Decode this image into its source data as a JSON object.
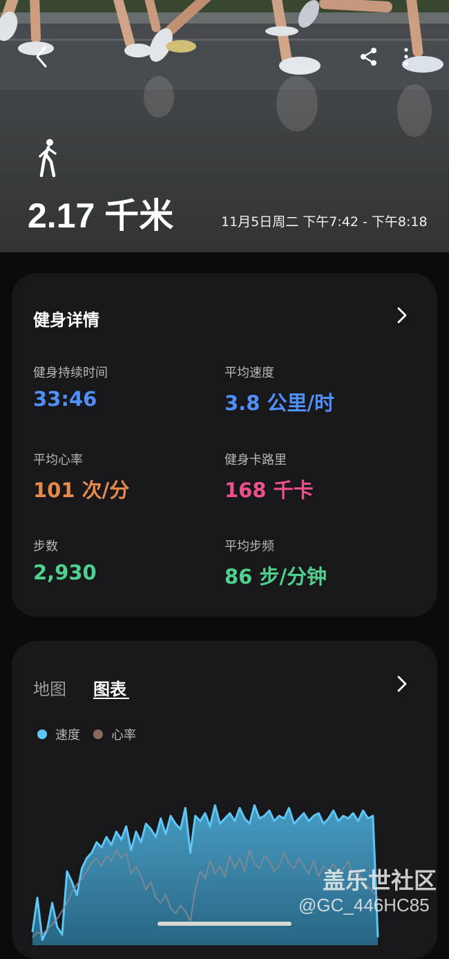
{
  "hero": {
    "distance": "2.17 千米",
    "datetime": "11月5日周二 下午7:42 - 下午8:18",
    "activity_icon": "walk-icon"
  },
  "details": {
    "title": "健身详情",
    "metrics": [
      {
        "label": "健身持续时间",
        "value": "33:46",
        "color": "#4f8ff7"
      },
      {
        "label": "平均速度",
        "value": "3.8 公里/时",
        "color": "#4f8ff7"
      },
      {
        "label": "平均心率",
        "value": "101 次/分",
        "color": "#e58a4c"
      },
      {
        "label": "健身卡路里",
        "value": "168 千卡",
        "color": "#ef4f8f"
      },
      {
        "label": "步数",
        "value": "2,930",
        "color": "#4fd08c"
      },
      {
        "label": "平均步频",
        "value": "86 步/分钟",
        "color": "#4fd08c"
      }
    ]
  },
  "chart_panel": {
    "tabs": [
      {
        "label": "地图",
        "active": false
      },
      {
        "label": "图表",
        "active": true
      }
    ],
    "legend": [
      {
        "label": "速度",
        "color": "#5ec6f5"
      },
      {
        "label": "心率",
        "color": "#8a6a5e"
      }
    ]
  },
  "chart_data": {
    "type": "area",
    "series": [
      {
        "name": "速度",
        "color": "#5ec6f5",
        "values": [
          0.5,
          1.8,
          0.2,
          0.6,
          1.6,
          0.7,
          0.4,
          2.8,
          2.4,
          1.9,
          2.9,
          3.3,
          3.5,
          3.9,
          3.7,
          4.1,
          3.8,
          4.3,
          4.0,
          4.5,
          3.6,
          4.3,
          3.9,
          4.6,
          4.4,
          4.1,
          4.8,
          4.2,
          4.9,
          4.6,
          4.4,
          5.2,
          3.5,
          4.9,
          4.7,
          5.0,
          4.5,
          5.3,
          4.6,
          4.8,
          5.0,
          4.7,
          5.2,
          4.8,
          4.6,
          5.3,
          4.8,
          4.9,
          5.1,
          4.7,
          4.9,
          4.8,
          5.2,
          4.6,
          4.8,
          5.0,
          4.7,
          4.9,
          5.0,
          4.6,
          4.8,
          5.1,
          4.7,
          4.9,
          4.8,
          5.0,
          4.7,
          5.1,
          4.8,
          4.9,
          0.3
        ]
      },
      {
        "name": "心率",
        "color": "#8a6a5e",
        "values": [
          0.3,
          0.5,
          0.4,
          0.6,
          0.8,
          1.0,
          1.3,
          1.6,
          2.0,
          2.3,
          2.5,
          2.8,
          3.1,
          3.3,
          3.0,
          3.4,
          3.2,
          3.6,
          3.3,
          3.5,
          2.7,
          3.0,
          2.6,
          2.1,
          2.4,
          1.8,
          1.6,
          1.9,
          1.4,
          1.2,
          1.5,
          1.3,
          0.9,
          2.1,
          2.8,
          2.5,
          3.2,
          2.7,
          3.0,
          2.6,
          3.4,
          2.9,
          3.3,
          2.8,
          3.6,
          3.1,
          2.9,
          3.4,
          3.2,
          2.8,
          3.0,
          3.5,
          3.1,
          2.9,
          3.3,
          3.0,
          2.7,
          3.2,
          2.6,
          3.0,
          2.8,
          3.1,
          2.7,
          2.9,
          3.2,
          2.6,
          2.8,
          2.4,
          2.2,
          2.0,
          1.8
        ]
      }
    ]
  },
  "watermark": {
    "line1": "盖乐世社区",
    "line2": "@GC_446HC85"
  }
}
